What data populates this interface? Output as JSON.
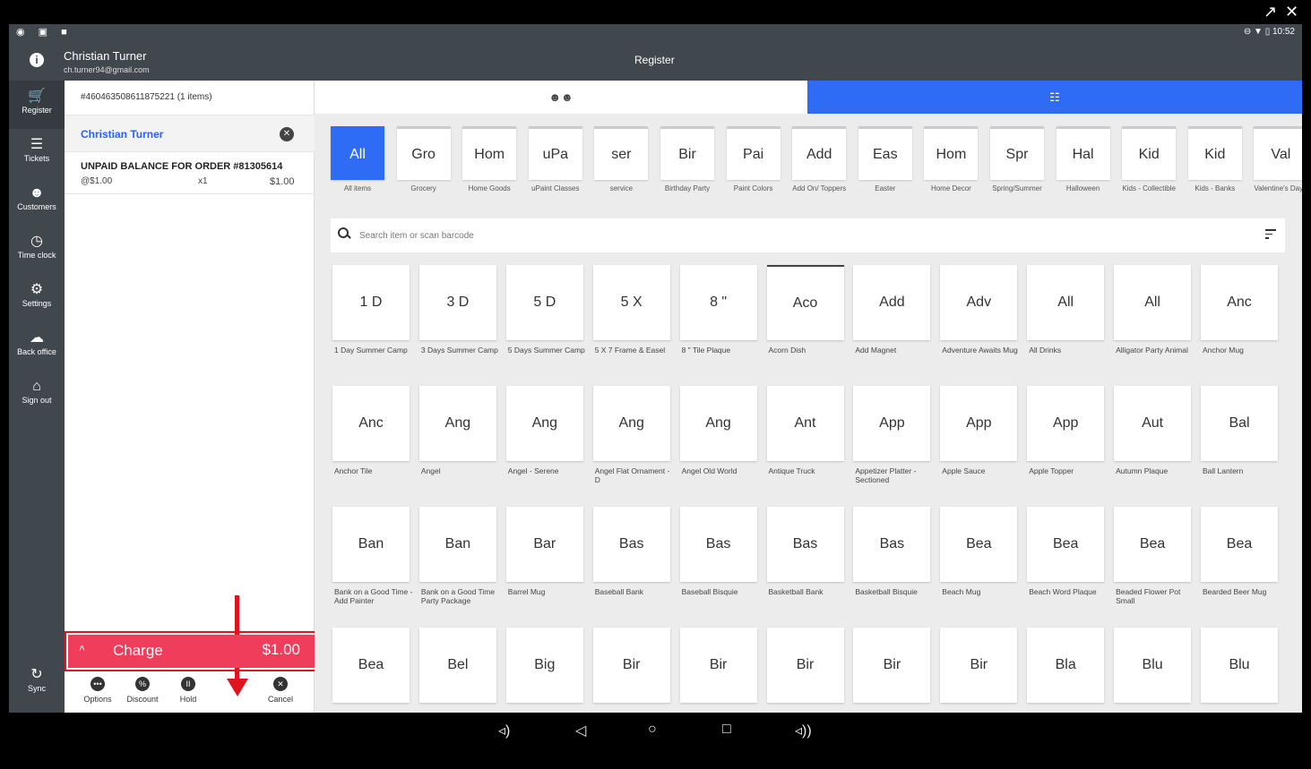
{
  "window": {
    "popout_icon": "external-link-icon",
    "close_icon": "close-icon"
  },
  "statusbar": {
    "left_icons": "◉ ▣ ■",
    "right": "⊖ ▼ ▯ 10:52"
  },
  "appbar": {
    "user_name": "Christian Turner",
    "user_email": "ch.turner94@gmail.com",
    "title": "Register"
  },
  "sidebar": {
    "items": [
      {
        "label": "Register",
        "icon": "🛒"
      },
      {
        "label": "Tickets",
        "icon": "☰"
      },
      {
        "label": "Customers",
        "icon": "☻"
      },
      {
        "label": "Time clock",
        "icon": "◷"
      },
      {
        "label": "Settings",
        "icon": "⚙"
      },
      {
        "label": "Back office",
        "icon": "☁"
      },
      {
        "label": "Sign out",
        "icon": "⌂"
      }
    ],
    "sync_label": "Sync",
    "sync_icon": "↻"
  },
  "order": {
    "number": "#460463508611875221 (1 items)",
    "customer": "Christian Turner",
    "line": {
      "title": "UNPAID BALANCE FOR ORDER #81305614",
      "price": "@$1.00",
      "qty": "x1",
      "total": "$1.00"
    },
    "charge_label": "Charge",
    "charge_amount": "$1.00",
    "chevron": "˄",
    "actions": [
      {
        "label": "Options",
        "glyph": "•••"
      },
      {
        "label": "Discount",
        "glyph": "%"
      },
      {
        "label": "Hold",
        "glyph": "II"
      },
      {
        "label": "Cancel",
        "glyph": "✕"
      }
    ]
  },
  "tabs": {
    "customers_icon": "☻☻",
    "grid_icon": "☷"
  },
  "categories": [
    {
      "tile": "All",
      "name": "All items"
    },
    {
      "tile": "Gro",
      "name": "Grocery"
    },
    {
      "tile": "Hom",
      "name": "Home Goods"
    },
    {
      "tile": "uPa",
      "name": "uPaint Classes"
    },
    {
      "tile": "ser",
      "name": "service"
    },
    {
      "tile": "Bir",
      "name": "Birthday Party"
    },
    {
      "tile": "Pai",
      "name": "Paint Colors"
    },
    {
      "tile": "Add",
      "name": "Add On/ Toppers"
    },
    {
      "tile": "Eas",
      "name": "Easter"
    },
    {
      "tile": "Hom",
      "name": "Home Decor"
    },
    {
      "tile": "Spr",
      "name": "Spring/Summer"
    },
    {
      "tile": "Hal",
      "name": "Halloween"
    },
    {
      "tile": "Kid",
      "name": "Kids - Collectible"
    },
    {
      "tile": "Kid",
      "name": "Kids - Banks"
    },
    {
      "tile": "Val",
      "name": "Valentine's Day"
    }
  ],
  "search": {
    "placeholder": "Search item or scan barcode"
  },
  "items": [
    {
      "tile": "1 D",
      "name": "1 Day Summer Camp"
    },
    {
      "tile": "3 D",
      "name": "3 Days Summer Camp"
    },
    {
      "tile": "5 D",
      "name": "5 Days Summer Camp"
    },
    {
      "tile": "5 X",
      "name": "5 X 7 Frame & Easel"
    },
    {
      "tile": "8 \"",
      "name": "8 \" Tile Plaque"
    },
    {
      "tile": "Aco",
      "name": "Acorn Dish"
    },
    {
      "tile": "Add",
      "name": "Add Magnet"
    },
    {
      "tile": "Adv",
      "name": "Adventure Awaits Mug"
    },
    {
      "tile": "All",
      "name": "All Drinks"
    },
    {
      "tile": "All",
      "name": "Alligator Party Animal"
    },
    {
      "tile": "Anc",
      "name": "Anchor Mug"
    },
    {
      "tile": "Anc",
      "name": "Anchor Tile"
    },
    {
      "tile": "Ang",
      "name": "Angel"
    },
    {
      "tile": "Ang",
      "name": "Angel - Serene"
    },
    {
      "tile": "Ang",
      "name": "Angel Flat Ornament - D"
    },
    {
      "tile": "Ang",
      "name": "Angel Old World"
    },
    {
      "tile": "Ant",
      "name": "Antique Truck"
    },
    {
      "tile": "App",
      "name": "Appetizer Platter - Sectioned"
    },
    {
      "tile": "App",
      "name": "Apple Sauce"
    },
    {
      "tile": "App",
      "name": "Apple Topper"
    },
    {
      "tile": "Aut",
      "name": "Autumn Plaque"
    },
    {
      "tile": "Bal",
      "name": "Ball Lantern"
    },
    {
      "tile": "Ban",
      "name": "Bank on a Good Time - Add Painter"
    },
    {
      "tile": "Ban",
      "name": "Bank on a Good Time Party Package"
    },
    {
      "tile": "Bar",
      "name": "Barrel Mug"
    },
    {
      "tile": "Bas",
      "name": "Baseball Bank"
    },
    {
      "tile": "Bas",
      "name": "Baseball Bisquie"
    },
    {
      "tile": "Bas",
      "name": "Basketball Bank"
    },
    {
      "tile": "Bas",
      "name": "Basketball Bisquie"
    },
    {
      "tile": "Bea",
      "name": "Beach Mug"
    },
    {
      "tile": "Bea",
      "name": "Beach Word Plaque"
    },
    {
      "tile": "Bea",
      "name": "Beaded Flower Pot Small"
    },
    {
      "tile": "Bea",
      "name": "Bearded Beer Mug"
    },
    {
      "tile": "Bea",
      "name": ""
    },
    {
      "tile": "Bel",
      "name": ""
    },
    {
      "tile": "Big",
      "name": ""
    },
    {
      "tile": "Bir",
      "name": ""
    },
    {
      "tile": "Bir",
      "name": ""
    },
    {
      "tile": "Bir",
      "name": ""
    },
    {
      "tile": "Bir",
      "name": ""
    },
    {
      "tile": "Bir",
      "name": ""
    },
    {
      "tile": "Bla",
      "name": ""
    },
    {
      "tile": "Blu",
      "name": ""
    },
    {
      "tile": "Blu",
      "name": ""
    }
  ],
  "navbar": {
    "vol_down": "◃)",
    "back": "◁",
    "home": "○",
    "recents": "□",
    "vol_up": "◃))"
  },
  "colors": {
    "accent": "#2f6cf6",
    "charge": "#ef3d5b",
    "annotation": "#e0141e",
    "chrome": "#40474d"
  }
}
